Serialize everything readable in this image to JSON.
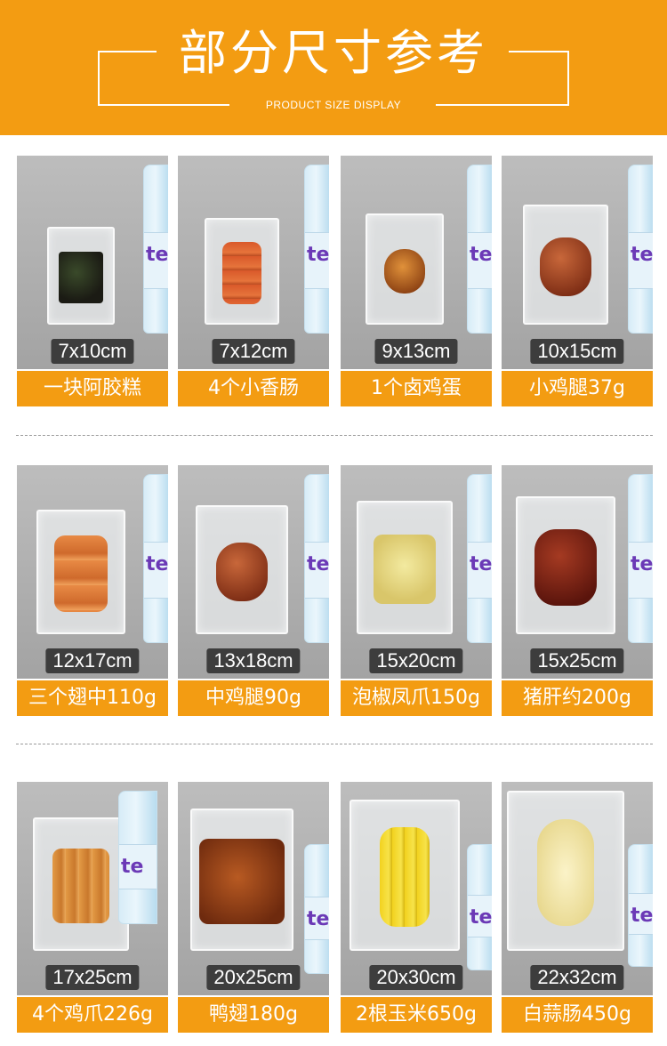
{
  "header": {
    "title": "部分尺寸参考",
    "subtitle": "PRODUCT SIZE DISPLAY"
  },
  "colors": {
    "accent": "#f39c12",
    "tag_bg": "#3d3d3d",
    "photo_bg": "#adadad"
  },
  "rows": [
    {
      "items": [
        {
          "size": "7x10cm",
          "name": "一块阿胶糕",
          "food": "dark-cake",
          "bag_fill": 0.2
        },
        {
          "size": "7x12cm",
          "name": "4个小香肠",
          "food": "sausages",
          "bag_fill": 0.3
        },
        {
          "size": "9x13cm",
          "name": "1个卤鸡蛋",
          "food": "braised-egg",
          "bag_fill": 0.35
        },
        {
          "size": "10x15cm",
          "name": "小鸡腿37g",
          "food": "chicken-leg",
          "bag_fill": 0.45
        }
      ]
    },
    {
      "items": [
        {
          "size": "12x17cm",
          "name": "三个翅中110g",
          "food": "chicken-wings",
          "bag_fill": 0.5
        },
        {
          "size": "13x18cm",
          "name": "中鸡腿90g",
          "food": "chicken-leg",
          "bag_fill": 0.55
        },
        {
          "size": "15x20cm",
          "name": "泡椒凤爪150g",
          "food": "chicken-feet-pale",
          "bag_fill": 0.6
        },
        {
          "size": "15x25cm",
          "name": "猪肝约200g",
          "food": "pork-liver",
          "bag_fill": 0.65
        }
      ]
    },
    {
      "items": [
        {
          "size": "17x25cm",
          "name": "4个鸡爪226g",
          "food": "chicken-feet",
          "bag_fill": 0.6
        },
        {
          "size": "20x25cm",
          "name": "鸭翅180g",
          "food": "duck-wings",
          "bag_fill": 0.7
        },
        {
          "size": "20x30cm",
          "name": "2根玉米650g",
          "food": "corn",
          "bag_fill": 0.8
        },
        {
          "size": "22x32cm",
          "name": "白蒜肠450g",
          "food": "garlic-sausage",
          "bag_fill": 0.9
        }
      ]
    }
  ]
}
